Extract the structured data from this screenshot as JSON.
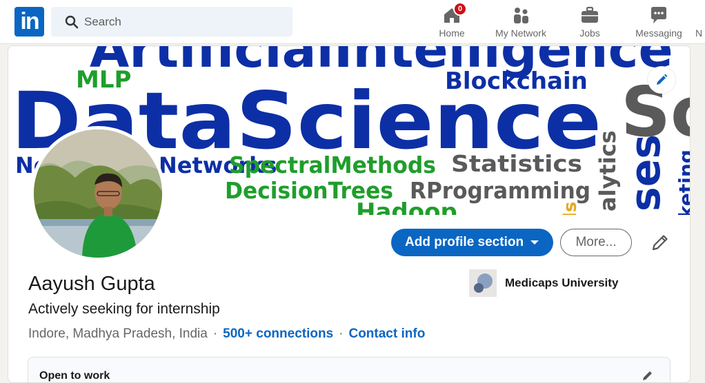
{
  "nav": {
    "logo": "in",
    "search_placeholder": "Search",
    "items": [
      {
        "label": "Home",
        "icon": "home-icon",
        "badge": "0"
      },
      {
        "label": "My Network",
        "icon": "people-icon"
      },
      {
        "label": "Jobs",
        "icon": "briefcase-icon"
      },
      {
        "label": "Messaging",
        "icon": "chat-icon"
      },
      {
        "label": "N"
      }
    ]
  },
  "banner": {
    "words": [
      "ArtificialIntelligence",
      "MLP",
      "Blockchain",
      "DataScience",
      "So",
      "Neural",
      "Networks",
      "SpectralMethods",
      "Statistics",
      "DecisionTrees",
      "RProgramming",
      "Hadoop",
      "alytics",
      "ses",
      "keting",
      "ls"
    ],
    "colors": {
      "blue": "#0d2fa6",
      "green": "#1f9e2b",
      "gray": "#5a5a5a",
      "orange": "#e8a71c"
    }
  },
  "profile": {
    "name": "Aayush Gupta",
    "headline": "Actively seeking for internship",
    "location": "Indore, Madhya Pradesh, India",
    "connections": "500+ connections",
    "contact": "Contact info",
    "education": "Medicaps University",
    "add_section": "Add profile section",
    "more": "More...",
    "open_to_work": "Open to work"
  },
  "colors": {
    "accent": "#0a66c2",
    "badge": "#cc1016"
  }
}
